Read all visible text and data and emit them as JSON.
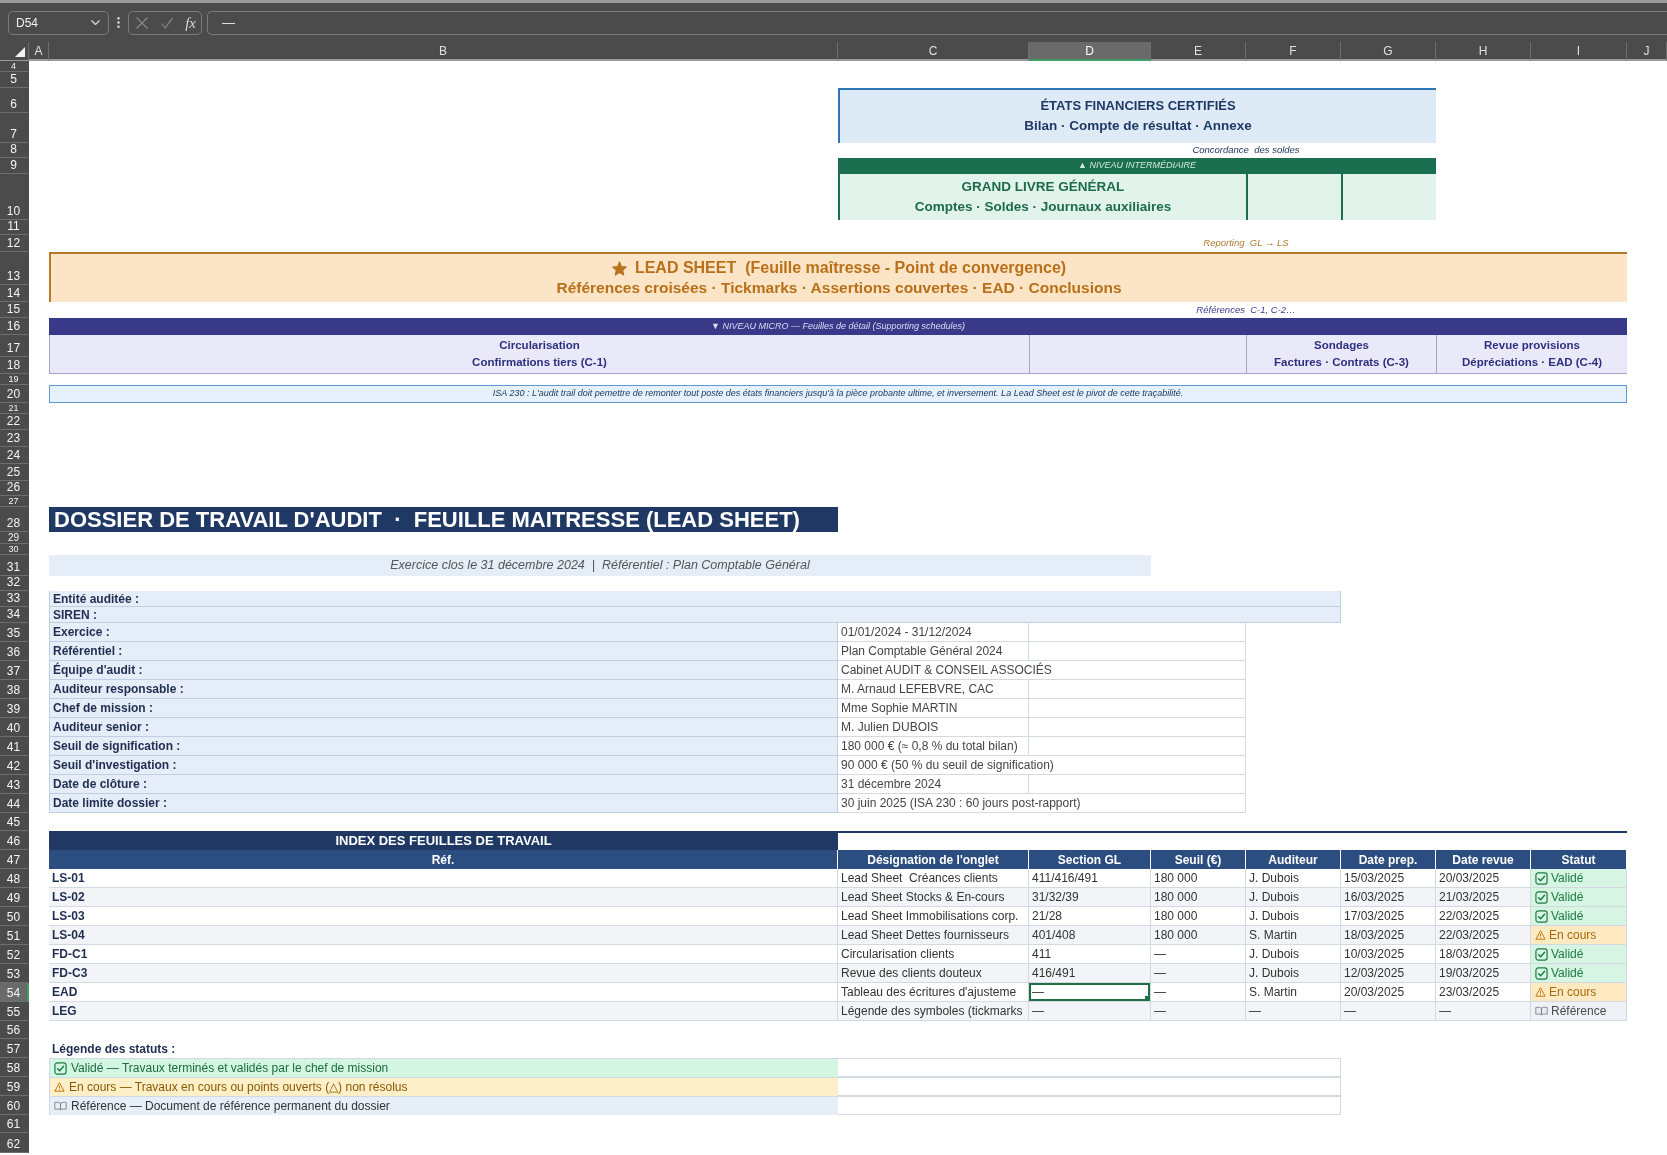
{
  "formula_bar": {
    "name_box": "D54",
    "function_label": "fx",
    "formula": "—"
  },
  "column_headers": [
    {
      "label": "A",
      "selected": false
    },
    {
      "label": "B",
      "selected": false
    },
    {
      "label": "C",
      "selected": false
    },
    {
      "label": "D",
      "selected": true
    },
    {
      "label": "E",
      "selected": false
    },
    {
      "label": "F",
      "selected": false
    },
    {
      "label": "G",
      "selected": false
    },
    {
      "label": "H",
      "selected": false
    },
    {
      "label": "I",
      "selected": false
    },
    {
      "label": "J",
      "selected": false
    }
  ],
  "row_headers": [
    {
      "label": "4",
      "selected": false
    },
    {
      "label": "5",
      "selected": false
    },
    {
      "label": "6",
      "selected": false
    },
    {
      "label": "7",
      "selected": false
    },
    {
      "label": "8",
      "selected": false
    },
    {
      "label": "9",
      "selected": false
    },
    {
      "label": "10",
      "selected": false
    },
    {
      "label": "11",
      "selected": false
    },
    {
      "label": "12",
      "selected": false
    },
    {
      "label": "13",
      "selected": false
    },
    {
      "label": "14",
      "selected": false
    },
    {
      "label": "15",
      "selected": false
    },
    {
      "label": "16",
      "selected": false
    },
    {
      "label": "17",
      "selected": false
    },
    {
      "label": "18",
      "selected": false
    },
    {
      "label": "19",
      "selected": false
    },
    {
      "label": "20",
      "selected": false
    },
    {
      "label": "21",
      "selected": false
    },
    {
      "label": "22",
      "selected": false
    },
    {
      "label": "23",
      "selected": false
    },
    {
      "label": "24",
      "selected": false
    },
    {
      "label": "25",
      "selected": false
    },
    {
      "label": "26",
      "selected": false
    },
    {
      "label": "27",
      "selected": false
    },
    {
      "label": "28",
      "selected": false
    },
    {
      "label": "29",
      "selected": false
    },
    {
      "label": "30",
      "selected": false
    },
    {
      "label": "31",
      "selected": false
    },
    {
      "label": "32",
      "selected": false
    },
    {
      "label": "33",
      "selected": false
    },
    {
      "label": "34",
      "selected": false
    },
    {
      "label": "35",
      "selected": false
    },
    {
      "label": "36",
      "selected": false
    },
    {
      "label": "37",
      "selected": false
    },
    {
      "label": "38",
      "selected": false
    },
    {
      "label": "39",
      "selected": false
    },
    {
      "label": "40",
      "selected": false
    },
    {
      "label": "41",
      "selected": false
    },
    {
      "label": "42",
      "selected": false
    },
    {
      "label": "43",
      "selected": false
    },
    {
      "label": "44",
      "selected": false
    },
    {
      "label": "45",
      "selected": false
    },
    {
      "label": "46",
      "selected": false
    },
    {
      "label": "47",
      "selected": false
    },
    {
      "label": "48",
      "selected": false
    },
    {
      "label": "49",
      "selected": false
    },
    {
      "label": "50",
      "selected": false
    },
    {
      "label": "51",
      "selected": false
    },
    {
      "label": "52",
      "selected": false
    },
    {
      "label": "53",
      "selected": false
    },
    {
      "label": "54",
      "selected": true
    },
    {
      "label": "55",
      "selected": false
    },
    {
      "label": "56",
      "selected": false
    },
    {
      "label": "57",
      "selected": false
    },
    {
      "label": "58",
      "selected": false
    },
    {
      "label": "59",
      "selected": false
    },
    {
      "label": "60",
      "selected": false
    },
    {
      "label": "61",
      "selected": false
    },
    {
      "label": "62",
      "selected": false
    }
  ],
  "audit_trail": {
    "financial_statements": {
      "title": "ÉTATS FINANCIERS CERTIFIÉS",
      "subtitle": "Bilan · Compte de résultat · Annexe"
    },
    "link_1": "Concordance  des soldes",
    "intermediate_banner": "▲ NIVEAU INTERMÉDIAIRE",
    "general_ledger": {
      "title": "GRAND LIVRE GÉNÉRAL",
      "subtitle": "Comptes · Soldes · Journaux auxiliaires"
    },
    "link_2": "Reporting  GL → LS",
    "lead_sheet": {
      "title": "LEAD SHEET  (Feuille maîtresse - Point de convergence)",
      "subtitle": "Références croisées · Tickmarks · Assertions couvertes · EAD · Conclusions"
    },
    "link_3": "Références  C-1, C-2…",
    "micro_banner": "▼ NIVEAU MICRO — Feuilles de détail (Supporting schedules)",
    "schedules": [
      {
        "title": "Circularisation",
        "subtitle": "Confirmations tiers (C-1)"
      },
      {
        "title": "Sondages",
        "subtitle": "Factures · Contrats (C-3)"
      },
      {
        "title": "Revue provisions",
        "subtitle": "Dépréciations · EAD (C-4)"
      }
    ],
    "note": "ISA 230 : L'audit trail doit pemettre de remonter tout poste des états financiers jusqu'à la pièce probante ultime, et inversement. La Lead Sheet est le pivot de cette traçabilité."
  },
  "title": "DOSSIER DE TRAVAIL D'AUDIT  ·  FEUILLE MAITRESSE (LEAD SHEET)",
  "subtitle": "Exercice clos le 31 décembre 2024  |  Référentiel : Plan Comptable Général",
  "engagement_info": [
    {
      "label": "Entité auditée :"
    },
    {
      "label": "SIREN :"
    },
    {
      "label": "Exercice :",
      "value": "01/01/2024 - 31/12/2024"
    },
    {
      "label": "Référentiel :",
      "value": "Plan Comptable Général 2024"
    },
    {
      "label": "Équipe d'audit :",
      "value": "Cabinet AUDIT & CONSEIL ASSOCIÉS"
    },
    {
      "label": "Auditeur responsable :",
      "value": "M. Arnaud LEFEBVRE, CAC"
    },
    {
      "label": "Chef de mission :",
      "value": "Mme Sophie MARTIN"
    },
    {
      "label": "Auditeur senior :",
      "value": "M. Julien DUBOIS"
    },
    {
      "label": "Seuil de signification :",
      "value": "180 000 € (≈ 0,8 % du total bilan)"
    },
    {
      "label": "Seuil d'investigation :",
      "value": "90 000 € (50 % du seuil de signification)"
    },
    {
      "label": "Date de clôture :",
      "value": "31 décembre 2024"
    },
    {
      "label": "Date limite dossier :",
      "value": "30 juin 2025 (ISA 230 : 60 jours post-rapport)"
    }
  ],
  "index": {
    "title": "INDEX DES FEUILLES DE TRAVAIL",
    "columns": [
      "Réf.",
      "Désignation de l'onglet",
      "Section GL",
      "Seuil (€)",
      "Auditeur",
      "Date prep.",
      "Date revue",
      "Statut"
    ],
    "rows": [
      {
        "ref": "LS-01",
        "designation": "Lead Sheet  Créances clients",
        "section_gl": "411/416/491",
        "seuil": "180 000",
        "auditeur": "J. Dubois",
        "date_prep": "15/03/2025",
        "date_revue": "20/03/2025",
        "status": {
          "kind": "validated",
          "label": "Validé"
        }
      },
      {
        "ref": "LS-02",
        "designation": "Lead Sheet Stocks & En-cours",
        "section_gl": "31/32/39",
        "seuil": "180 000",
        "auditeur": "J. Dubois",
        "date_prep": "16/03/2025",
        "date_revue": "21/03/2025",
        "status": {
          "kind": "validated",
          "label": "Validé"
        }
      },
      {
        "ref": "LS-03",
        "designation": "Lead Sheet Immobilisations corp.",
        "section_gl": "21/28",
        "seuil": "180 000",
        "auditeur": "J. Dubois",
        "date_prep": "17/03/2025",
        "date_revue": "22/03/2025",
        "status": {
          "kind": "validated",
          "label": "Validé"
        }
      },
      {
        "ref": "LS-04",
        "designation": "Lead Sheet Dettes fournisseurs",
        "section_gl": "401/408",
        "seuil": "180 000",
        "auditeur": "S. Martin",
        "date_prep": "18/03/2025",
        "date_revue": "22/03/2025",
        "status": {
          "kind": "in_progress",
          "label": "En cours"
        }
      },
      {
        "ref": "FD-C1",
        "designation": "Circularisation clients",
        "section_gl": "411",
        "seuil": "—",
        "auditeur": "J. Dubois",
        "date_prep": "10/03/2025",
        "date_revue": "18/03/2025",
        "status": {
          "kind": "validated",
          "label": "Validé"
        }
      },
      {
        "ref": "FD-C3",
        "designation": "Revue des clients douteux",
        "section_gl": "416/491",
        "seuil": "—",
        "auditeur": "J. Dubois",
        "date_prep": "12/03/2025",
        "date_revue": "19/03/2025",
        "status": {
          "kind": "validated",
          "label": "Validé"
        }
      },
      {
        "ref": "EAD",
        "designation": "Tableau des écritures d'ajusteme",
        "section_gl": "—",
        "seuil": "—",
        "auditeur": "S. Martin",
        "date_prep": "20/03/2025",
        "date_revue": "23/03/2025",
        "status": {
          "kind": "in_progress",
          "label": "En cours"
        }
      },
      {
        "ref": "LEG",
        "designation": "Légende des symboles (tickmarks",
        "section_gl": "—",
        "seuil": "—",
        "auditeur": "—",
        "date_prep": "—",
        "date_revue": "—",
        "status": {
          "kind": "reference",
          "label": "Référence"
        }
      }
    ]
  },
  "legend": {
    "title": "Légende des statuts :",
    "items": [
      {
        "kind": "validated",
        "text": "Validé — Travaux terminés et validés par le chef de mission"
      },
      {
        "kind": "in_progress",
        "text": "En cours — Travaux en cours ou points ouverts (△) non résolus"
      },
      {
        "kind": "reference",
        "text": "Référence — Document de référence permanent du dossier"
      }
    ]
  }
}
